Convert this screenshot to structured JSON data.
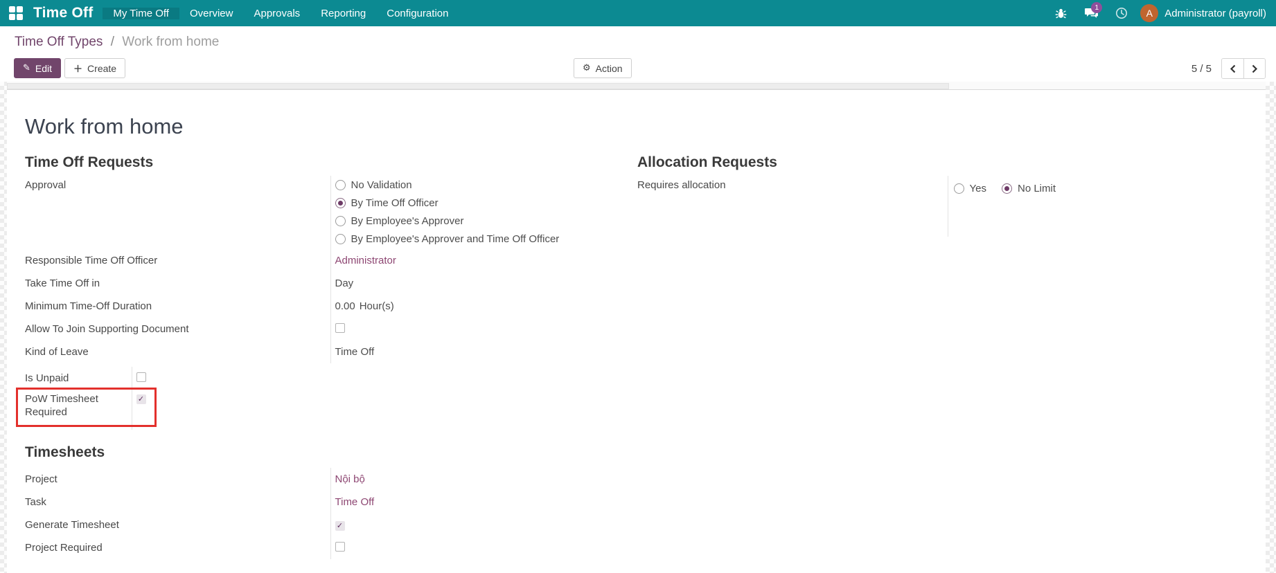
{
  "navbar": {
    "app_title": "Time Off",
    "menu": [
      {
        "label": "My Time Off",
        "active": true
      },
      {
        "label": "Overview",
        "active": false
      },
      {
        "label": "Approvals",
        "active": false
      },
      {
        "label": "Reporting",
        "active": false
      },
      {
        "label": "Configuration",
        "active": false
      }
    ],
    "icons": [
      "bug-icon",
      "messages-icon",
      "activities-clock-icon"
    ],
    "message_badge": "1",
    "avatar_initial": "A",
    "user_name": "Administrator (payroll)",
    "colors": {
      "navbar_bg": "#0c8a92",
      "active_item_bg": "#0a7a82",
      "badge_bg": "#8f4f9b",
      "avatar_bg": "#c0652f"
    }
  },
  "breadcrumb": {
    "parent": "Time Off Types",
    "separator": "/",
    "current": "Work from home"
  },
  "toolbar": {
    "edit_label": "Edit",
    "create_label": "Create",
    "action_label": "Action",
    "pager": "5 / 5"
  },
  "form": {
    "title": "Work from home",
    "sections": {
      "time_off_requests": {
        "heading": "Time Off Requests",
        "approval_label": "Approval",
        "approval_options": [
          {
            "label": "No Validation",
            "selected": false
          },
          {
            "label": "By Time Off Officer",
            "selected": true
          },
          {
            "label": "By Employee's Approver",
            "selected": false
          },
          {
            "label": "By Employee's Approver and Time Off Officer",
            "selected": false
          }
        ],
        "fields": [
          {
            "label": "Responsible Time Off Officer",
            "value": "Administrator",
            "type": "link"
          },
          {
            "label": "Take Time Off in",
            "value": "Day",
            "type": "text"
          },
          {
            "label": "Minimum Time-Off Duration",
            "value": "0.00",
            "suffix": "Hour(s)",
            "type": "text"
          },
          {
            "label": "Allow To Join Supporting Document",
            "type": "checkbox",
            "checked": false
          },
          {
            "label": "Kind of Leave",
            "value": "Time Off",
            "type": "text"
          }
        ]
      },
      "unpaid_group": {
        "fields": [
          {
            "label": "Is Unpaid",
            "type": "checkbox",
            "checked": false,
            "highlighted": false
          },
          {
            "label": "PoW Timesheet Required",
            "type": "checkbox",
            "checked": true,
            "highlighted": true
          }
        ],
        "annotation": {
          "shape": "red-box",
          "color": "#e3302c"
        }
      },
      "allocation_requests": {
        "heading": "Allocation Requests",
        "label": "Requires allocation",
        "options": [
          {
            "label": "Yes",
            "selected": false
          },
          {
            "label": "No Limit",
            "selected": true
          }
        ]
      },
      "timesheets": {
        "heading": "Timesheets",
        "fields": [
          {
            "label": "Project",
            "value": "Nội bộ",
            "type": "link"
          },
          {
            "label": "Task",
            "value": "Time Off",
            "type": "link"
          },
          {
            "label": "Generate Timesheet",
            "type": "checkbox",
            "checked": true
          },
          {
            "label": "Project Required",
            "type": "checkbox",
            "checked": false
          }
        ]
      }
    }
  },
  "colors": {
    "primary": "#71456b",
    "link": "#8d4672",
    "annotation_red": "#e3302c"
  }
}
